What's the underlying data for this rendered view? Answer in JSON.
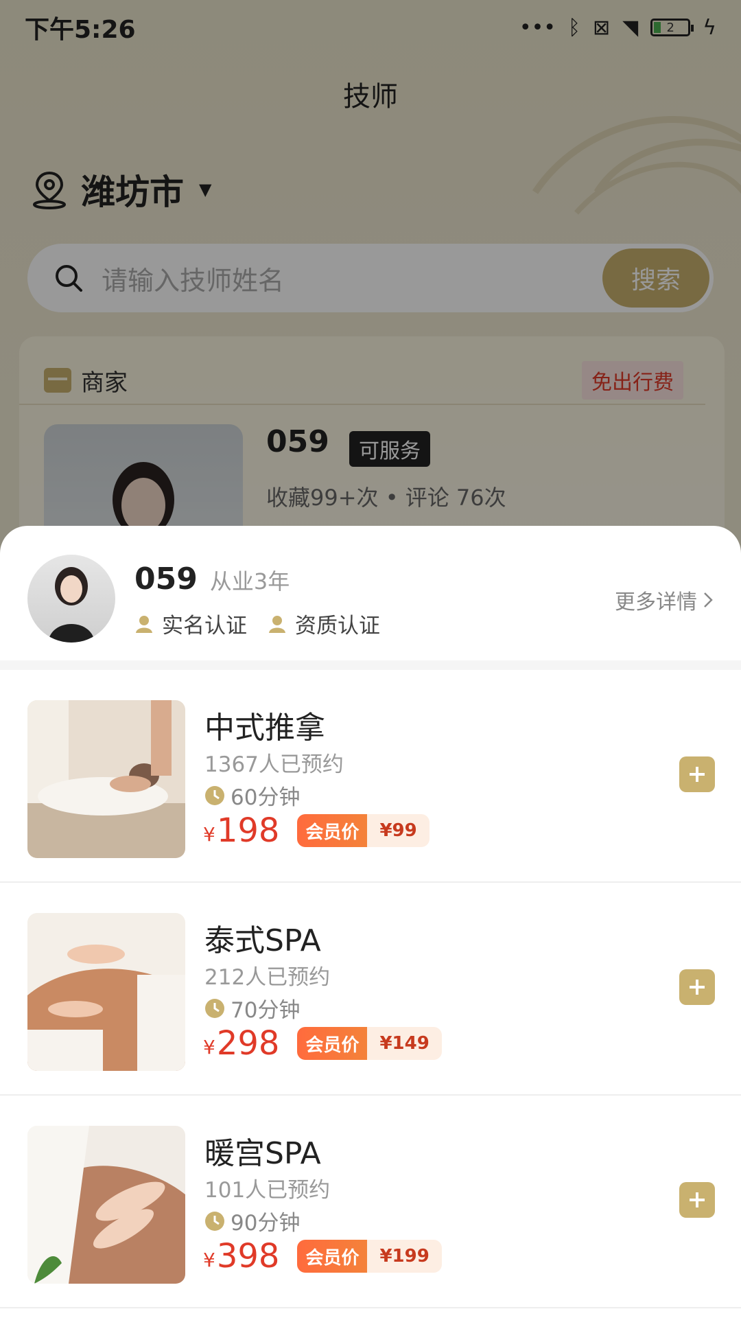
{
  "status_bar": {
    "time": "下午5:26",
    "battery": "2"
  },
  "nav": {
    "title": "技师"
  },
  "location": {
    "city": "潍坊市"
  },
  "search": {
    "placeholder": "请输入技师姓名",
    "button": "搜索"
  },
  "merchant_card": {
    "label": "商家",
    "tag": "免出行费",
    "tech_name": "059",
    "status": "可服务",
    "stats": "收藏99+次 • 评论 76次"
  },
  "tech": {
    "name": "059",
    "years": "从业3年",
    "cert_real_name": "实名认证",
    "cert_qualification": "资质认证",
    "more_details": "更多详情"
  },
  "services": [
    {
      "title": "中式推拿",
      "booked": "1367人已预约",
      "duration": "60分钟",
      "currency": "¥",
      "price": "198",
      "member_label": "会员价",
      "member_price": "¥99"
    },
    {
      "title": "泰式SPA",
      "booked": "212人已预约",
      "duration": "70分钟",
      "currency": "¥",
      "price": "298",
      "member_label": "会员价",
      "member_price": "¥149"
    },
    {
      "title": "暖宫SPA",
      "booked": "101人已预约",
      "duration": "90分钟",
      "currency": "¥",
      "price": "398",
      "member_label": "会员价",
      "member_price": "¥199"
    }
  ],
  "colors": {
    "accent_gold": "#c9b16f",
    "price_red": "#e03a28",
    "member_orange": "#ff6b3d"
  },
  "icons": {
    "location": "location-pin-icon",
    "search": "search-icon",
    "shop": "shop-icon",
    "person": "person-icon",
    "clock": "clock-icon",
    "add": "plus-icon",
    "chevron": "chevron-right-icon"
  }
}
